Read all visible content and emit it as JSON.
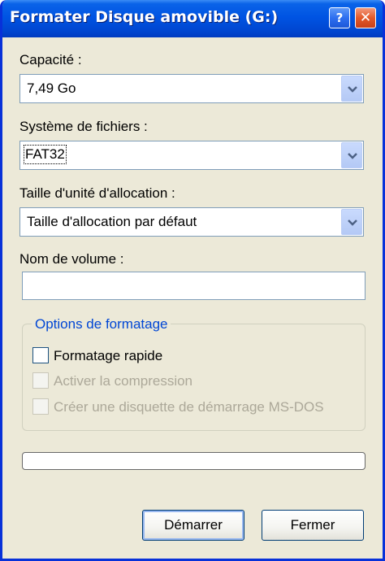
{
  "window": {
    "title": "Formater Disque amovible (G:)",
    "help_glyph": "?",
    "close_glyph": "✕"
  },
  "capacity": {
    "label": "Capacité :",
    "value": "7,49 Go"
  },
  "file_system": {
    "label": "Système de fichiers :",
    "value": "FAT32"
  },
  "allocation": {
    "label": "Taille d'unité d'allocation :",
    "value": "Taille d'allocation par défaut"
  },
  "volume": {
    "label": "Nom de volume :",
    "value": ""
  },
  "options": {
    "title": "Options de formatage",
    "quick_format": {
      "label": "Formatage rapide",
      "checked": false,
      "enabled": true
    },
    "compression": {
      "label": "Activer la compression",
      "checked": false,
      "enabled": false
    },
    "boot_disk": {
      "label": "Créer une disquette de démarrage MS-DOS",
      "checked": false,
      "enabled": false
    }
  },
  "progress": {
    "value": 0
  },
  "buttons": {
    "start": "Démarrer",
    "close": "Fermer"
  },
  "colors": {
    "title_bar": "#0054e3",
    "dialog_bg": "#ece9d8",
    "group_title": "#0046d5",
    "disabled_text": "#aca899",
    "close_button": "#e35a2a"
  },
  "icons": {
    "dropdown": "chevron-down-icon",
    "help": "help-icon",
    "close": "close-icon"
  }
}
